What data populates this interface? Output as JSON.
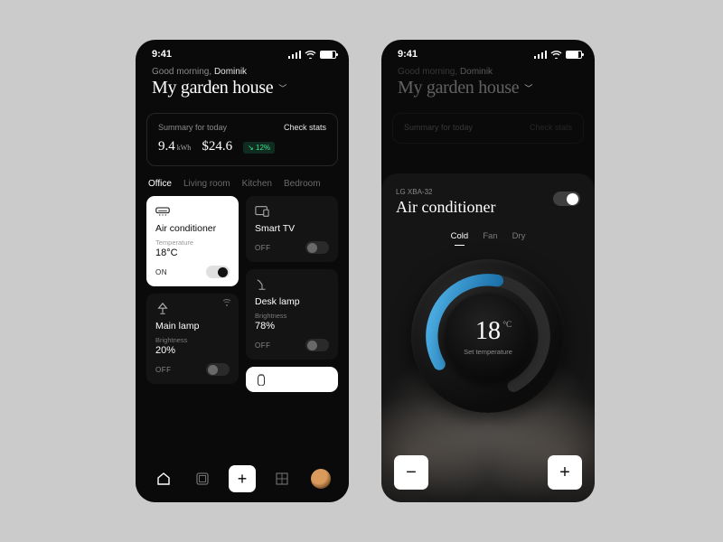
{
  "statusbar": {
    "time": "9:41"
  },
  "header": {
    "greeting_prefix": "Good morning, ",
    "username": "Dominik",
    "house_name": "My garden house"
  },
  "summary": {
    "label": "Summary for today",
    "check_label": "Check stats",
    "energy_value": "9.4",
    "energy_unit": "kWh",
    "cost": "$24.6",
    "delta": "↘ 12%"
  },
  "tabs": [
    "Office",
    "Living room",
    "Kitchen",
    "Bedroom"
  ],
  "devices": {
    "ac": {
      "name": "Air conditioner",
      "meta_label": "Temperature",
      "value": "18°C",
      "state": "ON"
    },
    "tv": {
      "name": "Smart TV",
      "state": "OFF"
    },
    "main": {
      "name": "Main lamp",
      "meta_label": "Brightness",
      "value": "20%",
      "state": "OFF"
    },
    "desk": {
      "name": "Desk lamp",
      "meta_label": "Brightness",
      "value": "78%",
      "state": "OFF"
    }
  },
  "nav": {
    "plus": "+"
  },
  "ac_sheet": {
    "model": "LG XBA-32",
    "title": "Air conditioner",
    "modes": [
      "Cold",
      "Fan",
      "Dry"
    ],
    "temp": "18",
    "temp_unit": "°C",
    "set_label": "Set temperature",
    "minus": "−",
    "plus": "+"
  }
}
